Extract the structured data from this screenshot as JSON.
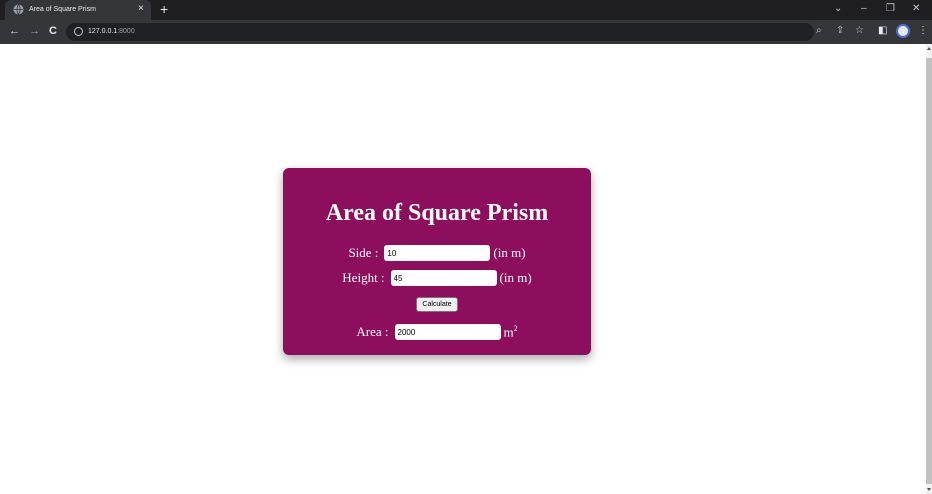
{
  "browser": {
    "tab": {
      "title": "Area of Square Prism",
      "close_label": "×"
    },
    "new_tab_label": "+",
    "window_controls": {
      "chevron": "⌄",
      "minimize": "–",
      "restore": "❐",
      "close": "✕"
    },
    "nav": {
      "back": "←",
      "forward": "→",
      "reload": "C"
    },
    "url": {
      "host": "127.0.0.1",
      "port": ":8000"
    },
    "icons": {
      "zoom": "⌕",
      "share": "⇪",
      "bookmark": "☆",
      "sidepanel": "◧",
      "menu": "⋮"
    }
  },
  "page": {
    "title": "Area of Square Prism",
    "side": {
      "label": "Side :",
      "value": "10",
      "unit": "(in m)"
    },
    "height": {
      "label": "Height :",
      "value": "45",
      "unit": "(in m)"
    },
    "calculate_label": "Calculate",
    "area": {
      "label": "Area :",
      "value": "2000",
      "unit": "m",
      "unit_exponent": "2"
    },
    "colors": {
      "card_background": "#8c0e5c",
      "text": "#ffffff"
    }
  }
}
